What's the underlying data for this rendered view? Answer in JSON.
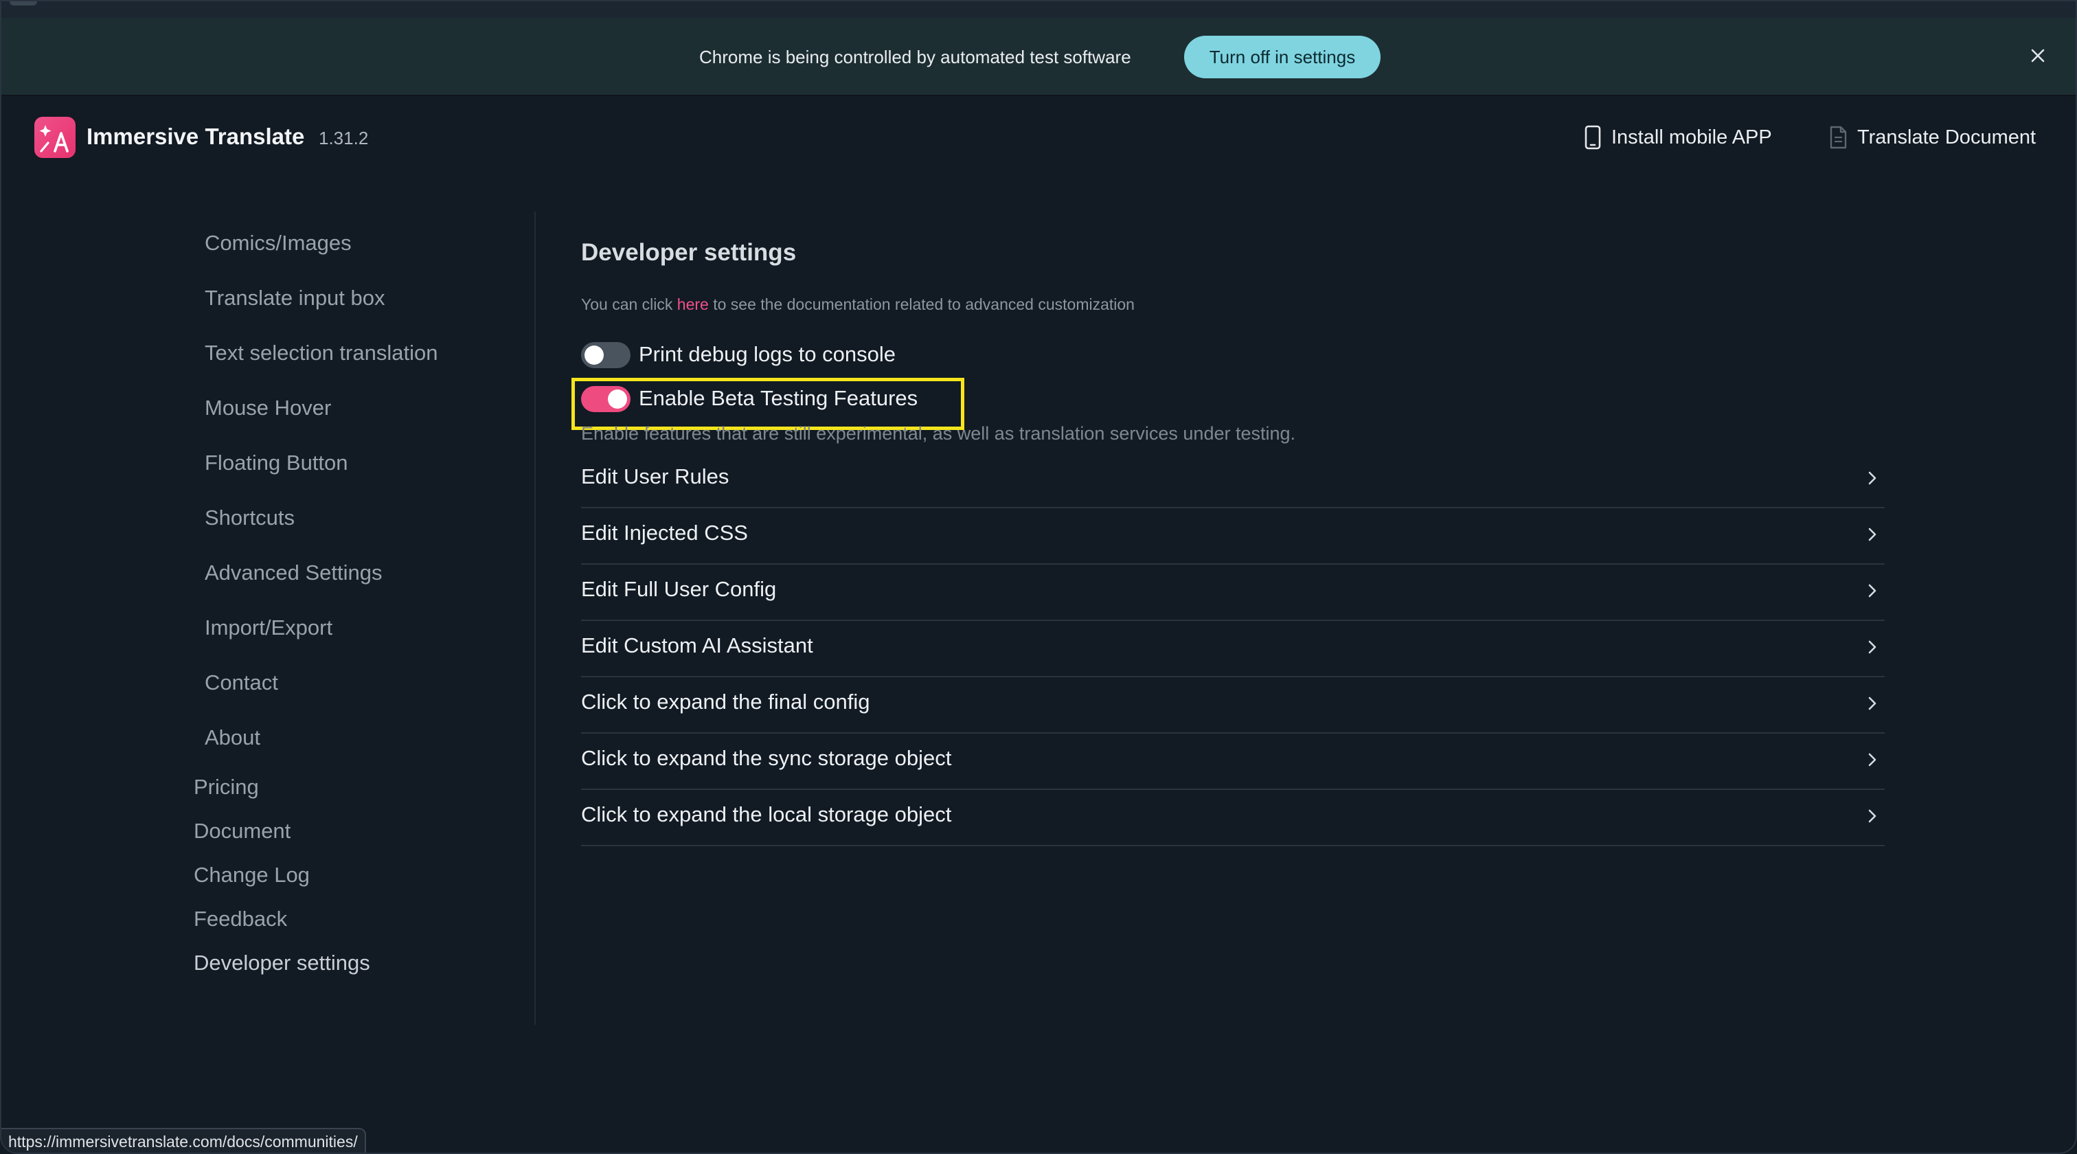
{
  "infobar": {
    "message": "Chrome is being controlled by automated test software",
    "button_label": "Turn off in settings"
  },
  "header": {
    "app_name": "Immersive Translate",
    "version": "1.31.2",
    "install_mobile_label": "Install mobile APP",
    "translate_document_label": "Translate Document"
  },
  "sidebar": {
    "sub_items": [
      {
        "label": "Comics/Images"
      },
      {
        "label": "Translate input box"
      },
      {
        "label": "Text selection translation"
      },
      {
        "label": "Mouse Hover"
      },
      {
        "label": "Floating Button"
      },
      {
        "label": "Shortcuts"
      },
      {
        "label": "Advanced Settings"
      },
      {
        "label": "Import/Export"
      },
      {
        "label": "Contact"
      },
      {
        "label": "About"
      }
    ],
    "top_items": [
      {
        "label": "Pricing"
      },
      {
        "label": "Document"
      },
      {
        "label": "Change Log"
      },
      {
        "label": "Feedback"
      },
      {
        "label": "Developer settings"
      }
    ]
  },
  "main": {
    "title": "Developer settings",
    "doc_hint_prefix": "You can click ",
    "doc_hint_link": "here",
    "doc_hint_suffix": " to see the documentation related to advanced customization",
    "debug_toggle": {
      "label": "Print debug logs to console",
      "enabled": false
    },
    "beta_toggle": {
      "label": "Enable Beta Testing Features",
      "enabled": true
    },
    "beta_description": "Enable features that are still experimental, as well as translation services under testing.",
    "rows": [
      {
        "label": "Edit User Rules"
      },
      {
        "label": "Edit Injected CSS"
      },
      {
        "label": "Edit Full User Config"
      },
      {
        "label": "Edit Custom AI Assistant"
      },
      {
        "label": "Click to expand the final config"
      },
      {
        "label": "Click to expand the sync storage object"
      },
      {
        "label": "Click to expand the local storage object"
      }
    ]
  },
  "status_bar": {
    "url": "https://immersivetranslate.com/docs/communities/"
  },
  "colors": {
    "accent": "#ee4b80",
    "highlight": "#f6e51c",
    "infobar_button": "#7fd4e0"
  }
}
